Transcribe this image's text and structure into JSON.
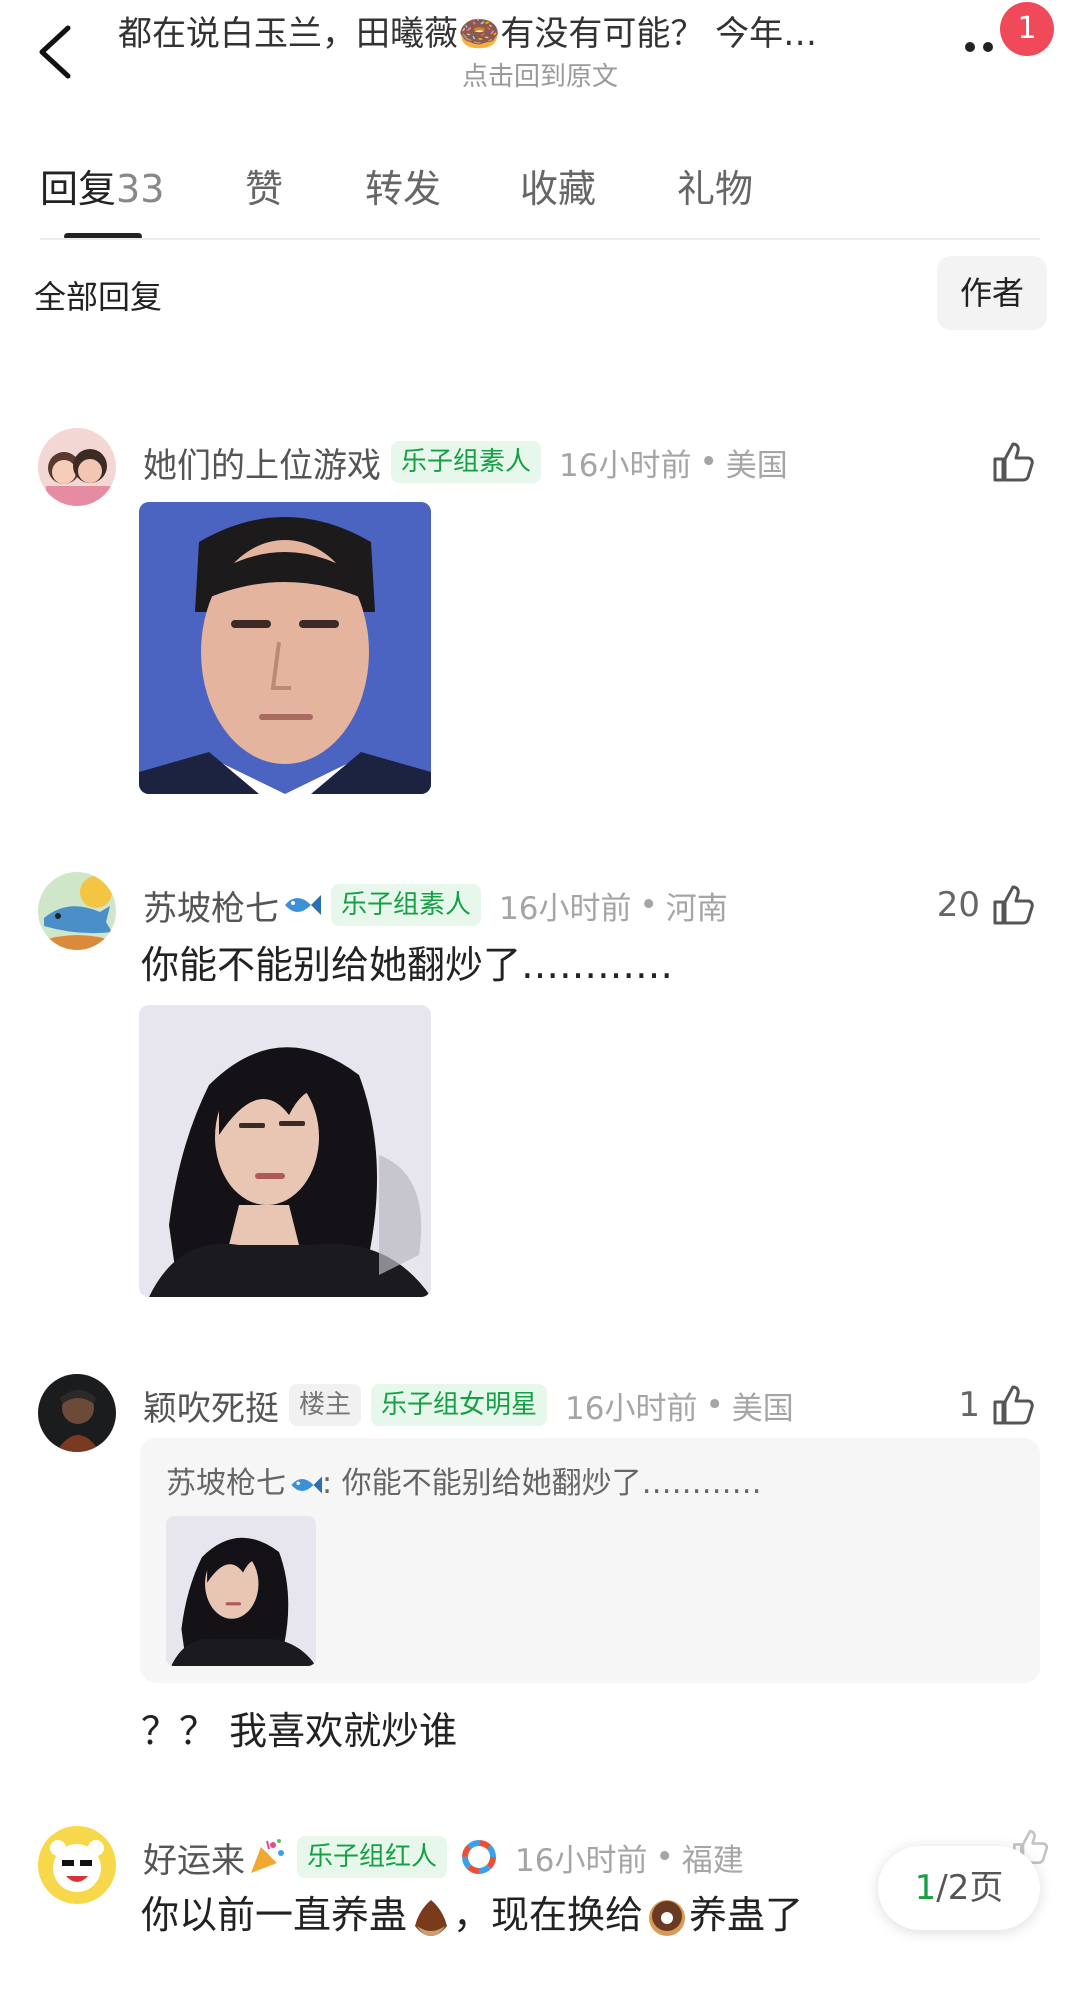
{
  "header": {
    "title": "都在说白玉兰，田曦薇🍩有没有可能？ 今年…",
    "subtitle": "点击回到原文",
    "notification_count": "1"
  },
  "tabs": [
    {
      "label": "回复",
      "count": "33"
    },
    {
      "label": "赞"
    },
    {
      "label": "转发"
    },
    {
      "label": "收藏"
    },
    {
      "label": "礼物"
    }
  ],
  "filter": {
    "label": "全部回复",
    "author_button": "作者"
  },
  "comments": [
    {
      "username": "她们的上位游戏",
      "badge": "乐子组素人",
      "time": "16小时前",
      "location": "美国",
      "likes": "",
      "image": "reaction-photo-man"
    },
    {
      "username": "苏坡枪七",
      "username_emoji": "fish",
      "badge": "乐子组素人",
      "time": "16小时前",
      "location": "河南",
      "likes": "20",
      "text": "你能不能别给她翻炒了…………",
      "image": "reaction-photo-woman"
    },
    {
      "username": "颖吹死挺",
      "role_badge": "楼主",
      "badge": "乐子组女明星",
      "time": "16小时前",
      "location": "美国",
      "likes": "1",
      "quote": {
        "username": "苏坡枪七",
        "text": ": 你能不能别给她翻炒了…………"
      },
      "text": "？？ 我喜欢就炒谁"
    },
    {
      "username": "好运来",
      "username_emoji": "party-popper",
      "badge": "乐子组红人",
      "time": "16小时前",
      "location": "福建",
      "text_a": "你以前一直养蛊",
      "text_b": "，现在换给",
      "text_c": "养蛊了"
    }
  ],
  "pager": {
    "current": "1",
    "total": "/2页"
  },
  "colors": {
    "accent_green": "#16a045",
    "badge_bg": "#e7f7ec",
    "notif_red": "#f04a5a"
  }
}
